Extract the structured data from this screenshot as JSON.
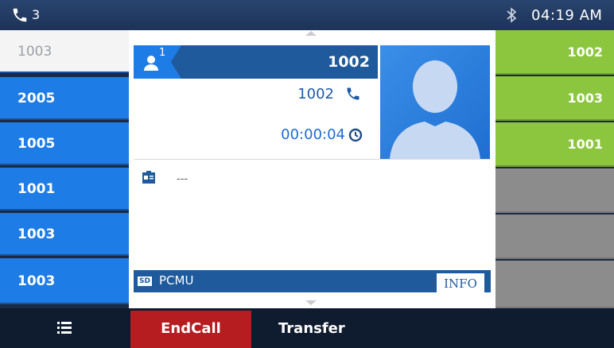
{
  "status": {
    "active_calls": "3",
    "time": "04:19 AM",
    "bluetooth_icon": "bluetooth-icon",
    "phone_icon": "phone-icon"
  },
  "left_keys": [
    {
      "label": "1003",
      "state": "active"
    },
    {
      "label": "2005",
      "state": "normal"
    },
    {
      "label": "1005",
      "state": "normal"
    },
    {
      "label": "1001",
      "state": "normal"
    },
    {
      "label": "1003",
      "state": "normal"
    },
    {
      "label": "1003",
      "state": "normal"
    }
  ],
  "right_keys": [
    {
      "label": "1002"
    },
    {
      "label": "1003"
    },
    {
      "label": "1001"
    },
    {
      "label": ""
    },
    {
      "label": ""
    },
    {
      "label": ""
    }
  ],
  "call": {
    "line_index": "1",
    "remote_name": "1002",
    "remote_number": "1002",
    "duration": "00:00:04"
  },
  "memo": {
    "text": "---"
  },
  "codec": {
    "hd_badge": "SD",
    "name": "PCMU",
    "info_label": "INFO"
  },
  "softkeys": {
    "end_call": "EndCall",
    "transfer": "Transfer"
  },
  "colors": {
    "line_key_blue": "#1e7ce6",
    "bria_green": "#8cc63e",
    "endcall_red": "#b51d21",
    "header_blue": "#1e5a9c"
  }
}
